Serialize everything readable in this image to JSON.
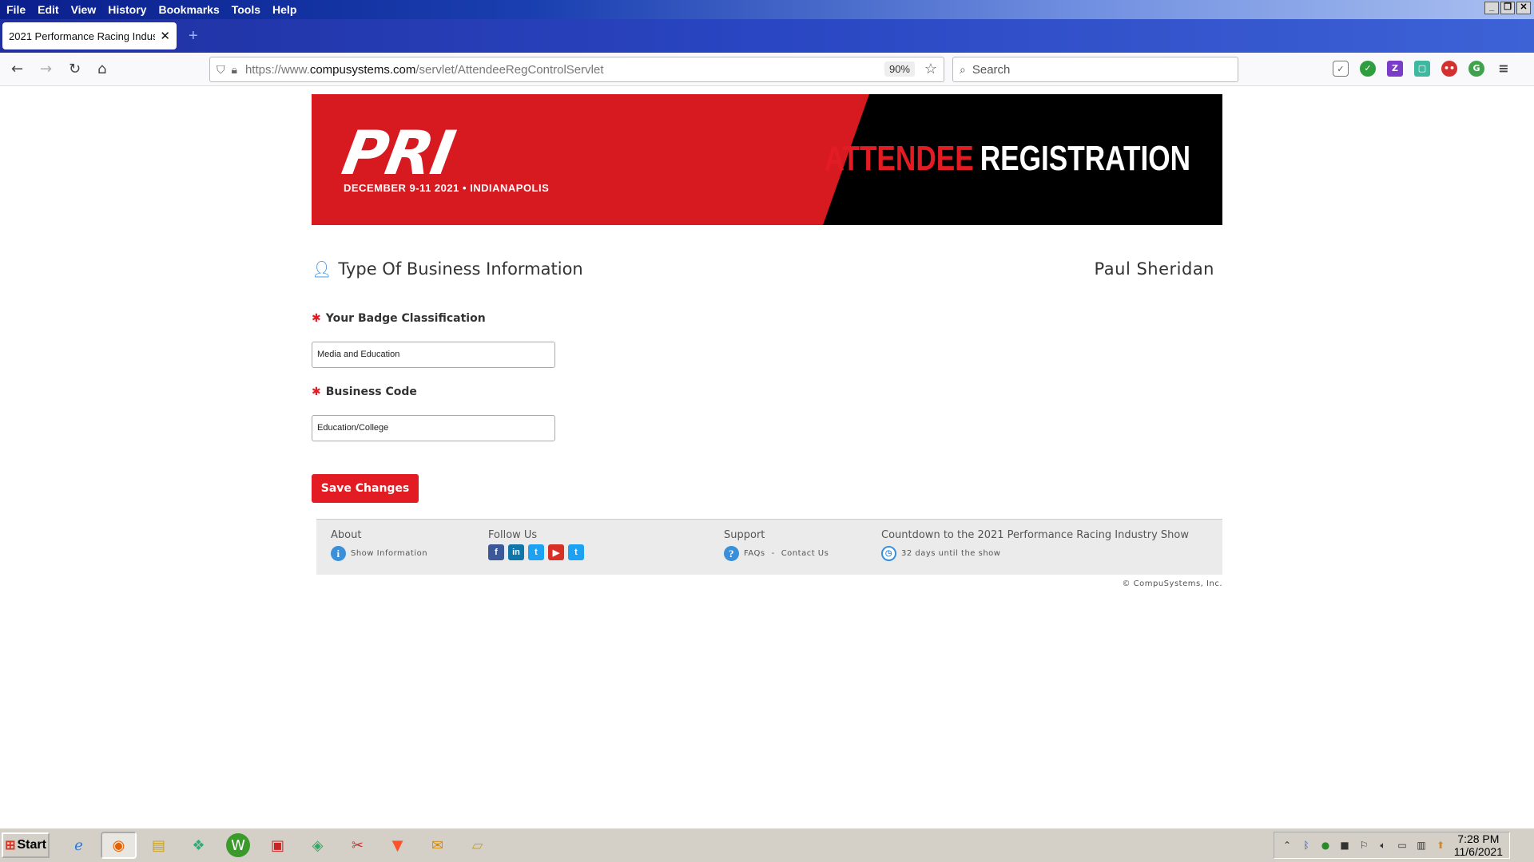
{
  "browser": {
    "menu": [
      "File",
      "Edit",
      "View",
      "History",
      "Bookmarks",
      "Tools",
      "Help"
    ],
    "tab_title": "2021 Performance Racing Indust",
    "url_prefix": "https://www.",
    "url_domain": "compusystems.com",
    "url_path": "/servlet/AttendeeRegControlServlet",
    "zoom": "90%",
    "search_placeholder": "Search"
  },
  "banner": {
    "logo": "PRI",
    "logo_sub": "DECEMBER 9-11 2021 • INDIANAPOLIS",
    "title_part1": "ATTENDEE",
    "title_part2": "REGISTRATION"
  },
  "page": {
    "section_title": "Type Of Business Information",
    "user_name": "Paul Sheridan",
    "badge_label": "Your Badge Classification",
    "badge_value": "Media and Education",
    "business_label": "Business Code",
    "business_value": "Education/College",
    "save_label": "Save Changes"
  },
  "footer": {
    "about_heading": "About",
    "about_link": "Show Information",
    "follow_heading": "Follow Us",
    "support_heading": "Support",
    "faqs": "FAQs",
    "sep": "-",
    "contact": "Contact Us",
    "countdown_heading": "Countdown to the 2021 Performance Racing Industry Show",
    "countdown_text": "32 days until the show",
    "copyright": "© CompuSystems, Inc."
  },
  "taskbar": {
    "start": "Start",
    "time": "7:28 PM",
    "date": "11/6/2021"
  },
  "colors": {
    "brand_red": "#e31b23",
    "link_blue": "#3a8fd9"
  }
}
